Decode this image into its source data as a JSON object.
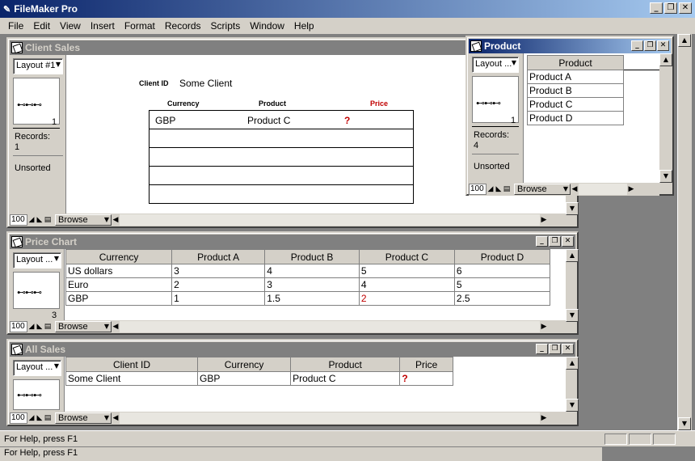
{
  "app": {
    "title": "FileMaker Pro",
    "status": "For Help, press F1",
    "status2": "For Help, press F1"
  },
  "menu": [
    "File",
    "Edit",
    "View",
    "Insert",
    "Format",
    "Records",
    "Scripts",
    "Window",
    "Help"
  ],
  "client_sales": {
    "title": "Client Sales",
    "layout": "Layout #1",
    "record_num": "1",
    "records_label": "Records:",
    "records_count": "1",
    "sort": "Unsorted",
    "zoom": "100",
    "mode": "Browse",
    "client_id_label": "Client ID",
    "client_id_value": "Some Client",
    "headers": {
      "currency": "Currency",
      "product": "Product",
      "price": "Price"
    },
    "row": {
      "currency": "GBP",
      "product": "Product C",
      "price": "?"
    }
  },
  "product": {
    "title": "Product",
    "layout": "Layout ...",
    "record_num": "1",
    "records_label": "Records:",
    "records_count": "4",
    "sort": "Unsorted",
    "zoom": "100",
    "mode": "Browse",
    "header": "Product",
    "items": [
      "Product A",
      "Product B",
      "Product C",
      "Product D"
    ]
  },
  "price_chart": {
    "title": "Price Chart",
    "layout": "Layout ...",
    "record_num": "3",
    "zoom": "100",
    "mode": "Browse",
    "headers": [
      "Currency",
      "Product A",
      "Product B",
      "Product C",
      "Product D"
    ],
    "rows": [
      [
        "US dollars",
        "3",
        "4",
        "5",
        "6"
      ],
      [
        "Euro",
        "2",
        "3",
        "4",
        "5"
      ],
      [
        "GBP",
        "1",
        "1.5",
        "2",
        "2.5"
      ]
    ]
  },
  "all_sales": {
    "title": "All Sales",
    "layout": "Layout ...",
    "zoom": "100",
    "mode": "Browse",
    "headers": [
      "Client ID",
      "Currency",
      "Product",
      "Price"
    ],
    "row": [
      "Some Client",
      "GBP",
      "Product C",
      "?"
    ]
  },
  "colors": {
    "accent": "#0a246a",
    "warning": "#c00000"
  }
}
